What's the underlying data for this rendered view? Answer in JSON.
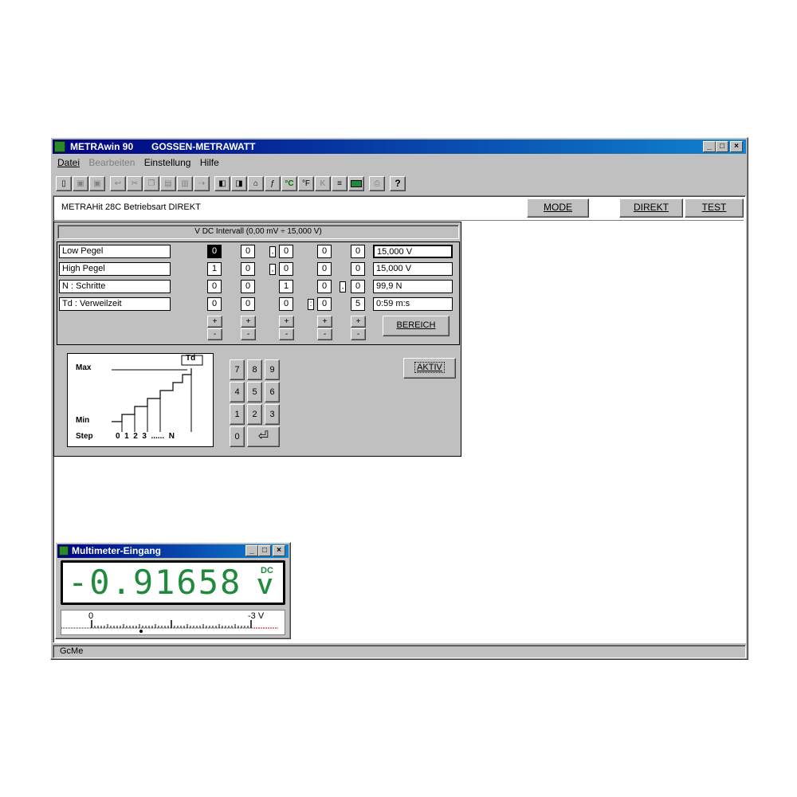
{
  "app": {
    "title": "METRAwin 90",
    "vendor": "GOSSEN-METRAWATT",
    "sys": {
      "min": "_",
      "max": "□",
      "close": "×"
    }
  },
  "menu": [
    "Datei",
    "Bearbeiten",
    "Einstellung",
    "Hilfe"
  ],
  "toolbar": {
    "help_label": "?",
    "unit_c": "°C",
    "unit_f": "°F",
    "unit_k": "K"
  },
  "status_header": {
    "text": "METRAHit 28C  Betriebsart DIREKT",
    "mode_button": "MODE",
    "direkt_button": "DIREKT",
    "test_button": "TEST"
  },
  "panel": {
    "title": "V DC Intervall  (0,00 mV ÷ 15,000 V)",
    "rows": [
      {
        "label": "Low Pegel",
        "digits": [
          "0",
          "0",
          "0",
          "0",
          "0"
        ],
        "sep1": ",",
        "sep2": "",
        "value": "15,000 V"
      },
      {
        "label": "High Pegel",
        "digits": [
          "1",
          "0",
          "0",
          "0",
          "0"
        ],
        "sep1": ",",
        "sep2": "",
        "value": "15,000 V"
      },
      {
        "label": "N : Schritte",
        "digits": [
          "0",
          "0",
          "1",
          "0",
          "0"
        ],
        "sep1": "",
        "sep2": ",",
        "value": "99,9 N"
      },
      {
        "label": "Td : Verweilzeit",
        "digits": [
          "0",
          "0",
          "0",
          "0",
          "5"
        ],
        "sep1": "",
        "sep2": ":",
        "value": "0:59 m:s"
      }
    ],
    "plus": "+",
    "minus": "-",
    "bereich_button": "BEREICH",
    "aktiv_button": "AKTIV",
    "diagram": {
      "max": "Max",
      "min": "Min",
      "step": "Step",
      "td": "Td",
      "ticks": "0  1  2  3  ......  N"
    },
    "keypad": [
      "7",
      "8",
      "9",
      "4",
      "5",
      "6",
      "1",
      "2",
      "3",
      "0"
    ],
    "enter_symbol": "⏎"
  },
  "multimeter": {
    "title": "Multimeter-Eingang",
    "reading": "-0.91658",
    "mode": "DC",
    "unit": "V",
    "scale_start": "0",
    "scale_end": "-3 V",
    "pointer_fraction": 0.31
  },
  "statusbar": {
    "text": "GcMe"
  },
  "colors": {
    "title_bar": "#000080",
    "lcd_digits": "#1e8a3a",
    "dialog_bg": "#c0c0c0",
    "window_bg": "#ffffff"
  }
}
